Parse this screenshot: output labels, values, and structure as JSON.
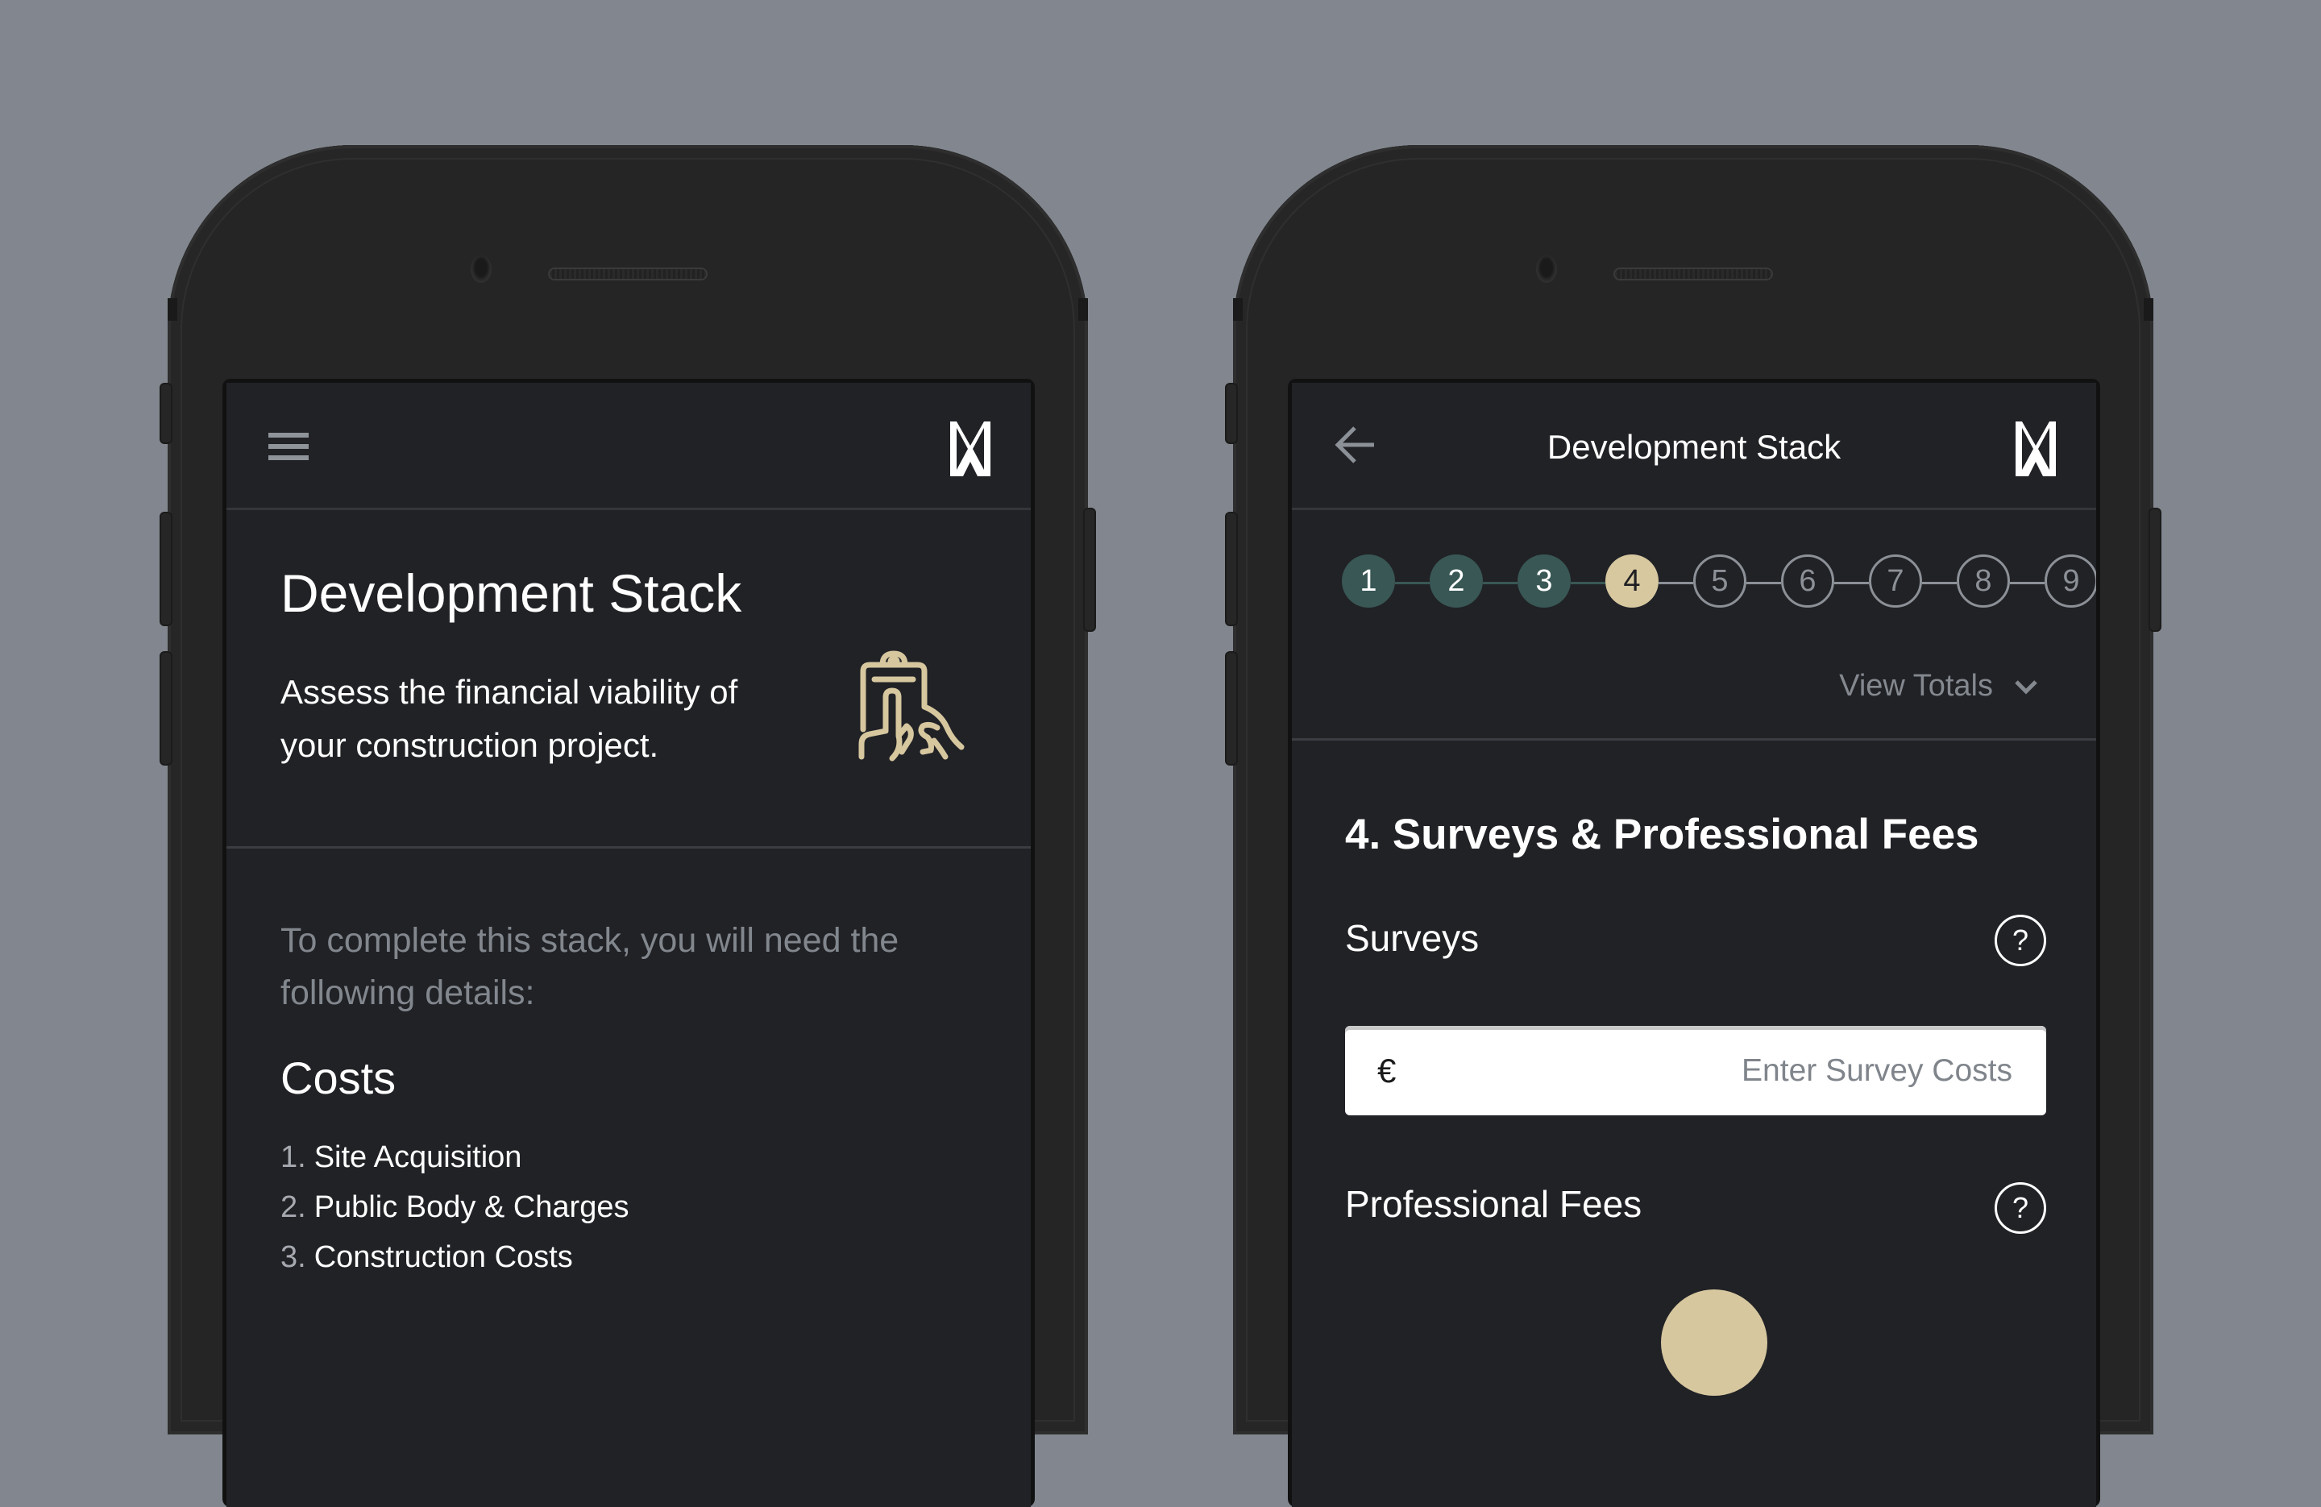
{
  "colors": {
    "background": "#82878f",
    "screen": "#212226",
    "step_done": "#385755",
    "step_current": "#d7c8a0",
    "step_todo": "#8c9097",
    "accent_gold": "#d6c79f",
    "muted_text": "#82878e"
  },
  "left_screen": {
    "appbar": {
      "menu_icon": "hamburger-icon",
      "logo": "brand-logo"
    },
    "intro": {
      "title": "Development Stack",
      "description": "Assess the financial viability of your construction project.",
      "icon": "clipboard-hand-icon"
    },
    "requirements_text": "To complete this stack, you will need the following details:",
    "costs": {
      "title": "Costs",
      "items": [
        {
          "num": "1.",
          "label": "Site Acquisition"
        },
        {
          "num": "2.",
          "label": "Public Body & Charges"
        },
        {
          "num": "3.",
          "label": "Construction Costs"
        }
      ]
    }
  },
  "right_screen": {
    "appbar": {
      "back_icon": "back-arrow-icon",
      "title": "Development Stack",
      "logo": "brand-logo"
    },
    "stepper": {
      "current_step": 4,
      "steps": [
        {
          "label": "1",
          "state": "done"
        },
        {
          "label": "2",
          "state": "done"
        },
        {
          "label": "3",
          "state": "done"
        },
        {
          "label": "4",
          "state": "current"
        },
        {
          "label": "5",
          "state": "todo"
        },
        {
          "label": "6",
          "state": "todo"
        },
        {
          "label": "7",
          "state": "todo"
        },
        {
          "label": "8",
          "state": "todo"
        },
        {
          "label": "9",
          "state": "todo"
        }
      ]
    },
    "view_totals_label": "View Totals",
    "section_heading": "4. Surveys & Professional Fees",
    "fields": [
      {
        "label": "Surveys",
        "help": "?",
        "currency": "€",
        "value": "",
        "placeholder": "Enter Survey Costs"
      },
      {
        "label": "Professional Fees",
        "help": "?"
      }
    ]
  }
}
